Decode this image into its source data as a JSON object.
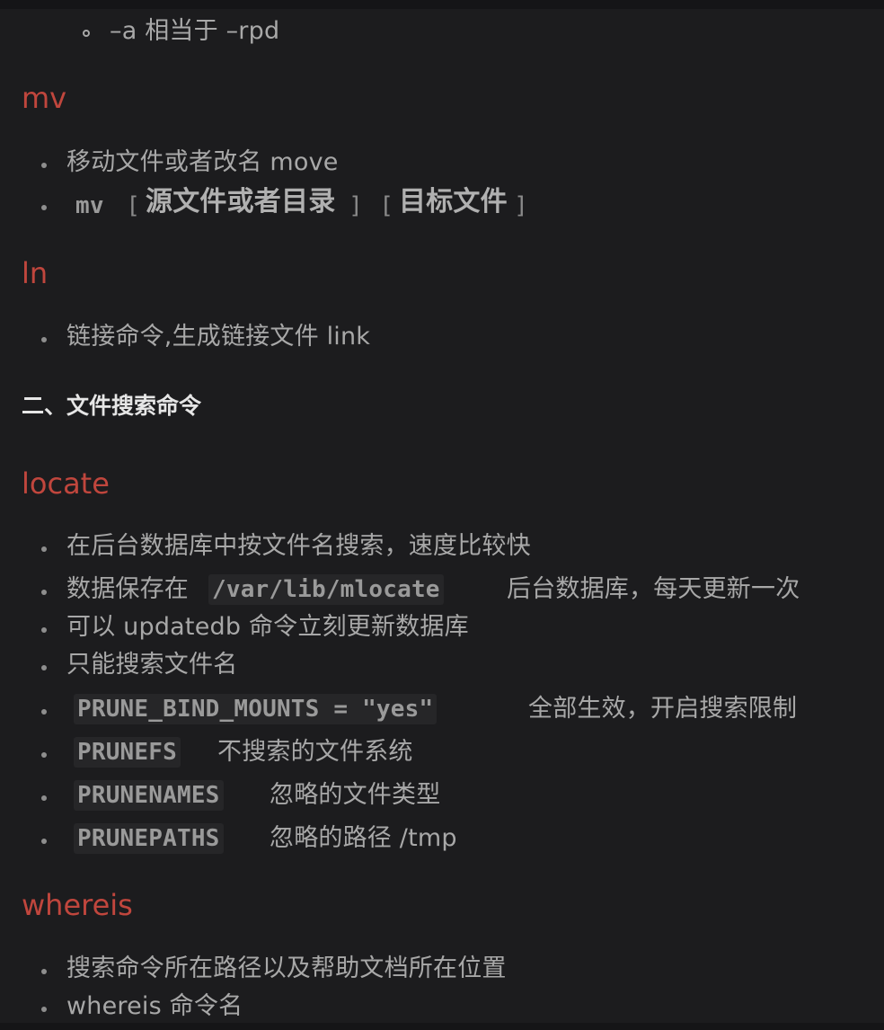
{
  "cp_tail": {
    "sub_item": "–a 相当于 –rpd"
  },
  "sections": {
    "mv": {
      "heading": "mv",
      "item1": "移动文件或者改名 move",
      "item2_cmd": "mv",
      "item2_open1": "[",
      "item2_src": "源文件或者目录",
      "item2_close1": "]",
      "item2_open2": "[",
      "item2_dst": "目标文件",
      "item2_close2": "]"
    },
    "ln": {
      "heading": "ln",
      "item1": "链接命令,生成链接文件 link"
    },
    "search_title": "二、文件搜索命令",
    "locate": {
      "heading": "locate",
      "item1": "在后台数据库中按文件名搜索，速度比较快",
      "item2_pre": "数据保存在",
      "item2_code": "/var/lib/mlocate",
      "item2_post": "后台数据库，每天更新一次",
      "item3": "可以 updatedb 命令立刻更新数据库",
      "item4": "只能搜索文件名",
      "item5_code": "PRUNE_BIND_MOUNTS = \"yes\"",
      "item5_post": "全部生效，开启搜索限制",
      "item6_code": "PRUNEFS",
      "item6_post": "不搜索的文件系统",
      "item7_code": "PRUNENAMES",
      "item7_post": "忽略的文件类型",
      "item8_code": "PRUNEPATHS",
      "item8_post": "忽略的路径 /tmp"
    },
    "whereis": {
      "heading": "whereis",
      "item1": "搜索命令所在路径以及帮助文档所在位置",
      "item2": "whereis 命令名"
    }
  },
  "colors": {
    "background": "#1c1c1e",
    "heading": "#c0463d",
    "text": "#a8a8a8",
    "subheading": "#e6e6e6"
  }
}
